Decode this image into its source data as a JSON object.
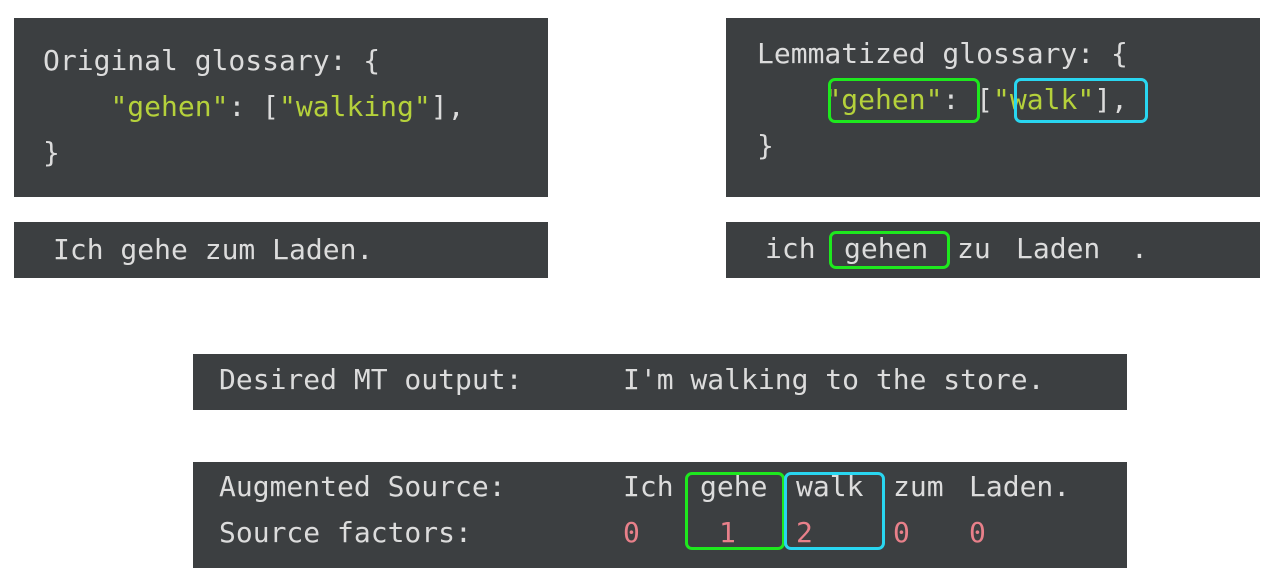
{
  "original_glossary": {
    "head": "Original glossary",
    "open": ": {",
    "key": "\"gehen\"",
    "sep": ": [",
    "value": "\"walking\"",
    "close_entry": "],",
    "close": "}"
  },
  "lemmatized_glossary": {
    "head": "Lemmatized glossary",
    "open": ": {",
    "key": "\"gehen\"",
    "sep": ": [",
    "value": "\"walk\"",
    "close_entry": "],",
    "close": "}"
  },
  "original_sentence": "Ich gehe zum Laden.",
  "lemmatized_sentence": {
    "w1": "ich",
    "w2": "gehen",
    "w3": "zu",
    "w4": "Laden",
    "w5": "."
  },
  "desired": {
    "label": "Desired MT output:",
    "text": "I'm walking to the store."
  },
  "augmented": {
    "label": "Augmented Source:",
    "words": [
      "Ich",
      "gehe",
      "walk",
      "zum",
      "Laden."
    ]
  },
  "factors": {
    "label": "Source factors:",
    "values": [
      "0",
      "1",
      "2",
      "0",
      "0"
    ]
  },
  "colors": {
    "panel": "#3c3f41",
    "string": "#b5d13b",
    "factor": "#e8808a",
    "highlight_green": "#1ee81e",
    "highlight_cyan": "#29d6f0"
  }
}
